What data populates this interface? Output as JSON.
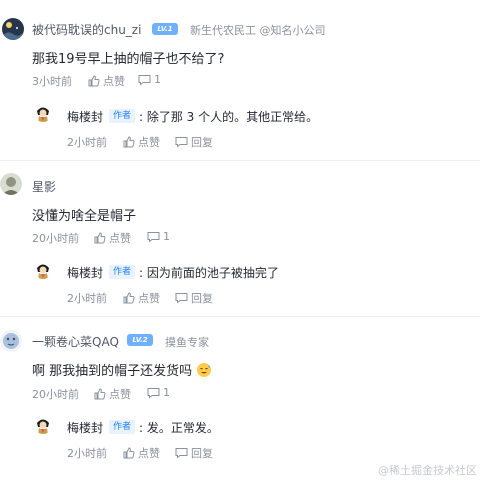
{
  "comments": [
    {
      "user": "被代码耽误的chu_zi",
      "level": "LV.1",
      "title": "新生代农民工 @知名小公司",
      "content": "那我19号早上抽的帽子也不给了?",
      "time": "3小时前",
      "like_label": "点赞",
      "reply_count": "1",
      "reply": {
        "user": "梅楼封",
        "tag": "作者",
        "text": ": 除了那 3 个人的。其他正常给。",
        "time": "2小时前",
        "like_label": "点赞",
        "reply_label": "回复"
      }
    },
    {
      "user": "星影",
      "content": "没懂为啥全是帽子",
      "time": "20小时前",
      "like_label": "点赞",
      "reply_count": "1",
      "reply": {
        "user": "梅楼封",
        "tag": "作者",
        "text": ": 因为前面的池子被抽完了",
        "time": "2小时前",
        "like_label": "点赞",
        "reply_label": "回复"
      }
    },
    {
      "user": "一颗卷心菜QAQ",
      "level": "LV.2",
      "title": "摸鱼专家",
      "content": "啊 那我抽到的帽子还发货吗",
      "time": "20小时前",
      "like_label": "点赞",
      "reply_count": "1",
      "reply": {
        "user": "梅楼封",
        "tag": "作者",
        "text": ": 发。正常发。",
        "time": "2小时前",
        "like_label": "点赞",
        "reply_label": "回复"
      }
    }
  ],
  "watermark": "@稀土掘金技术社区",
  "colors": {
    "accent": "#1e80ff",
    "level": "#6fb1ff",
    "meta": "#8a919f"
  }
}
